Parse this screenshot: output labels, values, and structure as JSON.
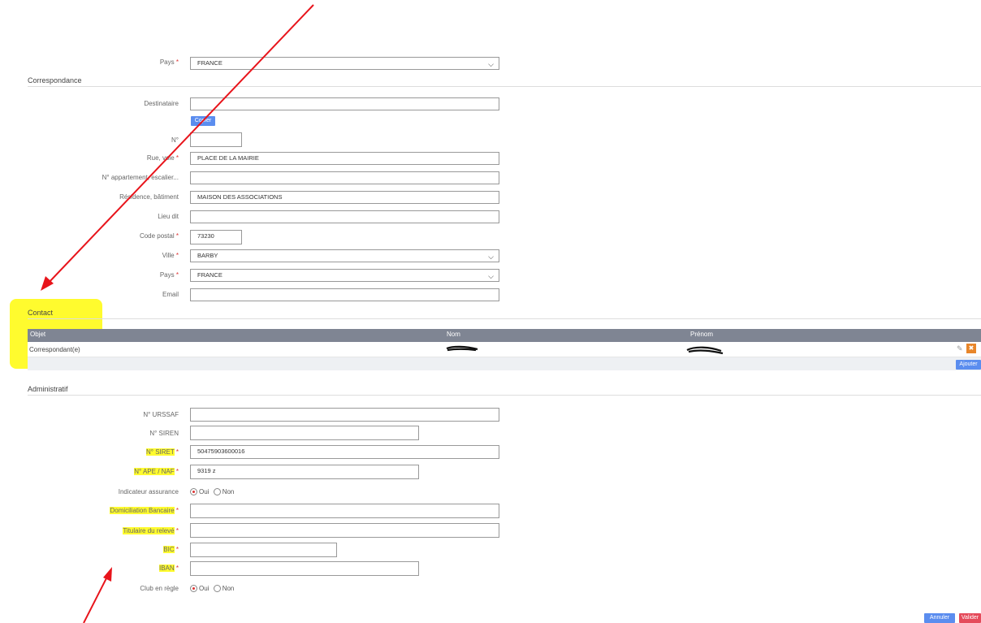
{
  "adresse": {
    "pays_label": "Pays",
    "pays_value": "FRANCE"
  },
  "correspondance": {
    "section_title": "Correspondance",
    "destinataire_label": "Destinataire",
    "destinataire_value": "",
    "copier_button": "Copier",
    "numero_label": "N°",
    "numero_value": "",
    "rue_label": "Rue, voie",
    "rue_value": "PLACE DE LA MAIRIE",
    "appartement_label": "N° appartement, escalier...",
    "appartement_value": "",
    "residence_label": "Résidence, bâtiment",
    "residence_value": "MAISON DES ASSOCIATIONS",
    "lieu_dit_label": "Lieu dit",
    "lieu_dit_value": "",
    "code_postal_label": "Code postal",
    "code_postal_value": "73230",
    "ville_label": "Ville",
    "ville_value": "BARBY",
    "pays_label": "Pays",
    "pays_value": "FRANCE",
    "email_label": "Email",
    "email_value": ""
  },
  "contact": {
    "section_title": "Contact",
    "columns": [
      "Objet",
      "Nom",
      "Prénom"
    ],
    "rows": [
      {
        "objet": "Correspondant(e)"
      }
    ],
    "ajouter_button": "Ajouter"
  },
  "administratif": {
    "section_title": "Administratif",
    "urssaf_label": "N° URSSAF",
    "urssaf_value": "",
    "siren_label": "N° SIREN",
    "siren_value": "",
    "siret_label": "N° SIRET",
    "siret_value": "50475903600016",
    "ape_label": "N° APE / NAF",
    "ape_value": "9319 z",
    "assurance_label": "Indicateur assurance",
    "oui_label": "Oui",
    "non_label": "Non",
    "domiciliation_label": "Domiciliation Bancaire",
    "domiciliation_value": "",
    "titulaire_label": "Titulaire du relevé",
    "titulaire_value": "",
    "bic_label": "BIC",
    "bic_value": "",
    "iban_label": "IBAN",
    "iban_value": "",
    "club_label": "Club en règle"
  },
  "footer": {
    "annuler_button": "Annuler",
    "valider_button": "Valider"
  },
  "colors": {
    "highlight": "#fffb2e",
    "annotation_arrow": "#e8141b",
    "button_blue": "#5b8def",
    "button_red": "#e54b5b",
    "edit_orange": "#e8862a",
    "table_header": "#7f8593"
  }
}
